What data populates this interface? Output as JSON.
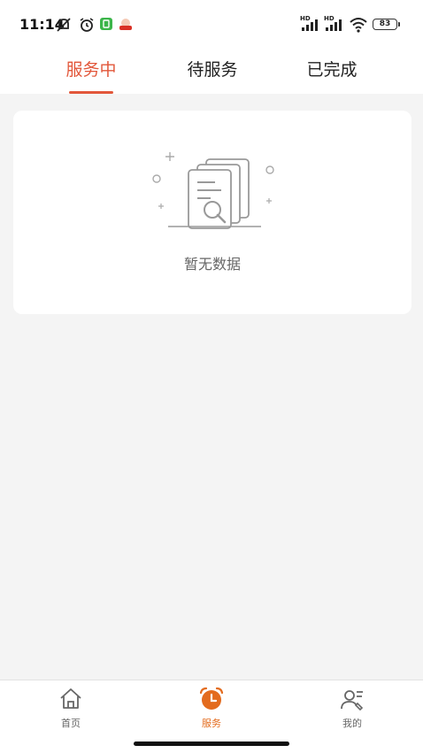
{
  "status_bar": {
    "time": "11:14",
    "battery": "83",
    "signal_labels": [
      "HD",
      "HD"
    ]
  },
  "tabs": [
    {
      "label": "服务中",
      "active": true
    },
    {
      "label": "待服务",
      "active": false
    },
    {
      "label": "已完成",
      "active": false
    }
  ],
  "empty_state": {
    "text": "暂无数据"
  },
  "bottom_nav": {
    "items": [
      {
        "label": "首页",
        "icon": "home-icon",
        "active": false
      },
      {
        "label": "服务",
        "icon": "alarm-clock-icon",
        "active": true
      },
      {
        "label": "我的",
        "icon": "user-list-icon",
        "active": false
      }
    ]
  },
  "colors": {
    "accent_tab": "#e2573a",
    "accent_nav": "#e36b1e",
    "background": "#f4f4f4"
  }
}
